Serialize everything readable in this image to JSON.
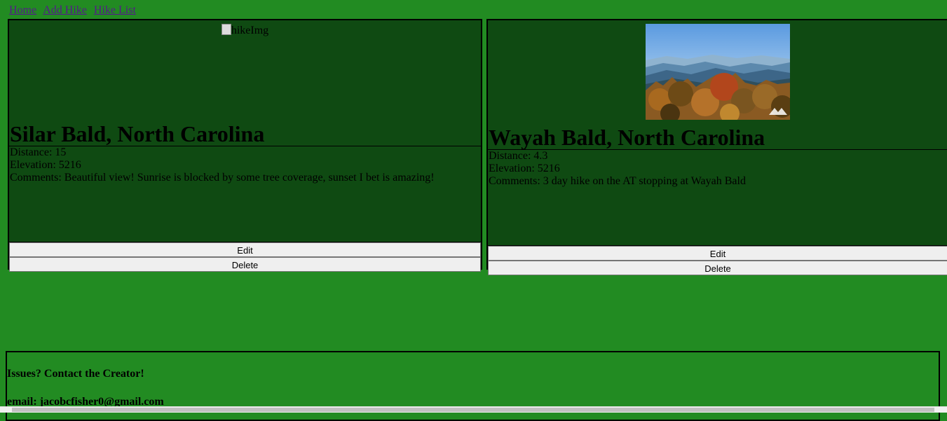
{
  "nav": {
    "links": [
      "Home",
      "Add Hike",
      "Hike List"
    ]
  },
  "hikes": [
    {
      "image_alt": "hikeImg",
      "title": "Silar Bald, North Carolina",
      "distance": "Distance: 15",
      "elevation": "Elevation: 5216",
      "comments": "Comments: Beautiful view! Sunrise is blocked by some tree coverage, sunset I bet is amazing!",
      "edit_label": "Edit",
      "delete_label": "Delete"
    },
    {
      "title": "Wayah Bald, North Carolina",
      "distance": "Distance: 4.3",
      "elevation": "Elevation: 5216",
      "comments": "Comments: 3 day hike on the AT stopping at Wayah Bald",
      "edit_label": "Edit",
      "delete_label": "Delete"
    }
  ],
  "footer": {
    "heading": "Issues? Contact the Creator!",
    "email": "email: jacobcfisher0@gmail.com"
  },
  "colors": {
    "page_bg": "#228b22",
    "card_bg": "#0f4a12"
  }
}
